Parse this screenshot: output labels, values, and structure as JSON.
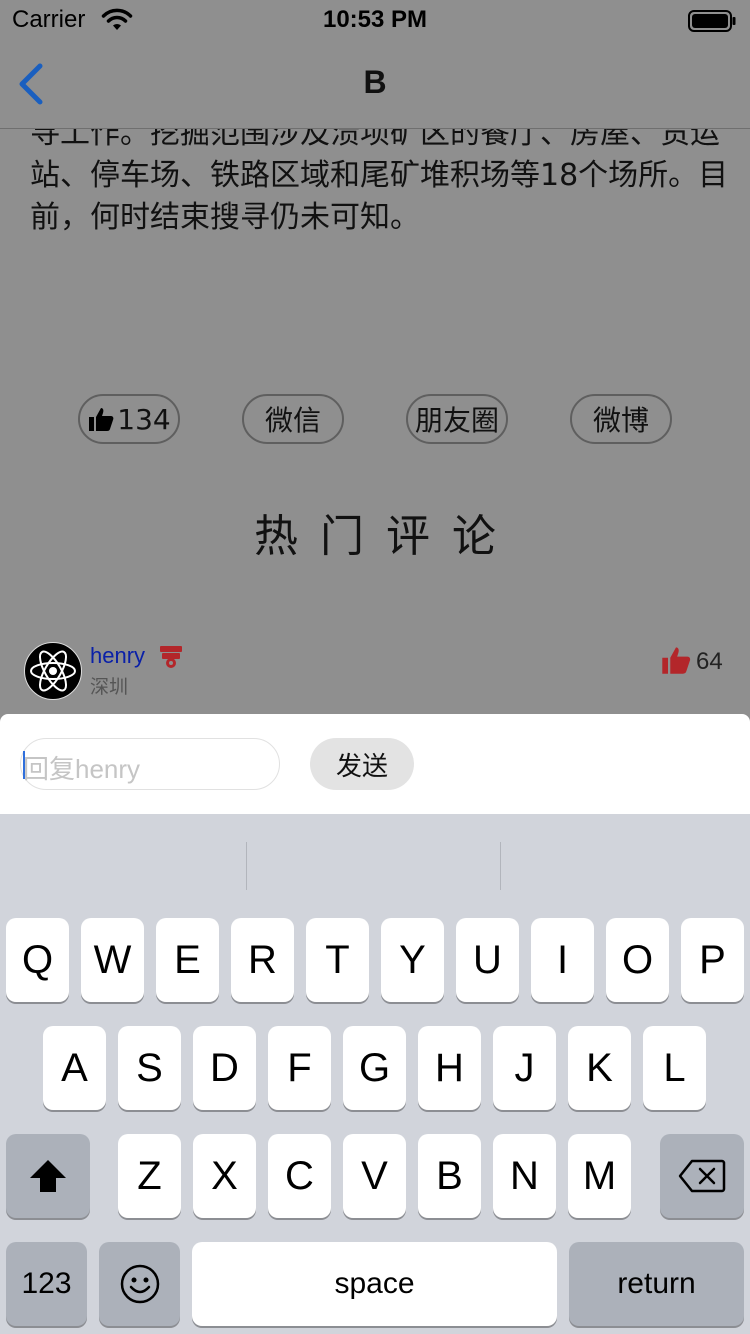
{
  "status_bar": {
    "carrier": "Carrier",
    "time": "10:53 PM"
  },
  "nav": {
    "title": "B"
  },
  "article": {
    "lines": [
      "寻工作。挖掘范围涉及溃坝矿区的餐厅、房屋、货运",
      "站、停车场、铁路区域和尾矿堆积场等18个场所。目",
      "前，何时结束搜寻仍未可知。"
    ]
  },
  "actions": {
    "like_count": "134",
    "wechat": "微信",
    "moments": "朋友圈",
    "weibo": "微博"
  },
  "section_title": "热门评论",
  "comment": {
    "username": "henry",
    "location": "深圳",
    "likes": "64"
  },
  "reply": {
    "placeholder": "回复henry",
    "send_label": "发送"
  },
  "keyboard": {
    "row1": [
      "Q",
      "W",
      "E",
      "R",
      "T",
      "Y",
      "U",
      "I",
      "O",
      "P"
    ],
    "row2": [
      "A",
      "S",
      "D",
      "F",
      "G",
      "H",
      "J",
      "K",
      "L"
    ],
    "row3": [
      "Z",
      "X",
      "C",
      "V",
      "B",
      "N",
      "M"
    ],
    "numbers_label": "123",
    "space_label": "space",
    "return_label": "return"
  },
  "colors": {
    "username": "#0a20a8",
    "like_red": "#b3262a",
    "back_blue": "#1a5fbf"
  }
}
